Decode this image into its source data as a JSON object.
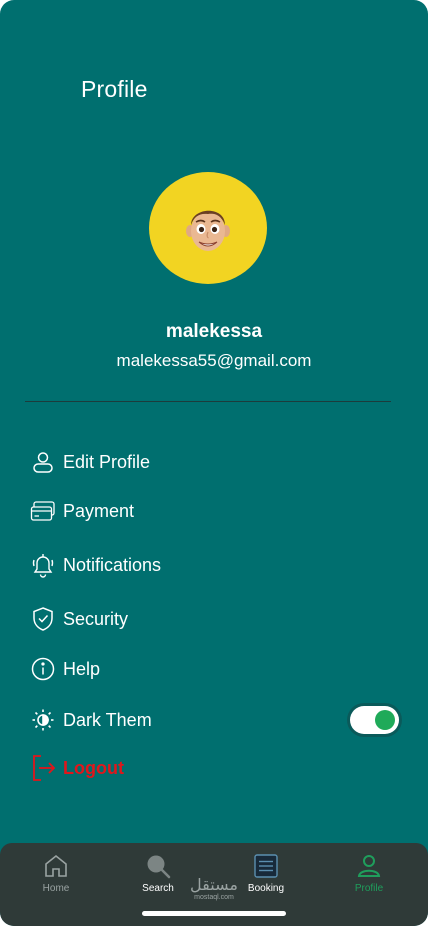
{
  "page": {
    "title": "Profile"
  },
  "user": {
    "name": "malekessa",
    "email": "malekessa55@gmail.com"
  },
  "menu": {
    "edit_profile": "Edit Profile",
    "payment": "Payment",
    "notifications": "Notifications",
    "security": "Security",
    "help": "Help",
    "dark_theme": "Dark Them",
    "logout": "Logout"
  },
  "settings": {
    "dark_theme_enabled": true
  },
  "nav": {
    "home": "Home",
    "search": "Search",
    "booking": "Booking",
    "profile": "Profile",
    "active": "profile"
  },
  "watermark": {
    "arabic": "مستقل",
    "latin": "mostaql.com"
  },
  "colors": {
    "background": "#006f6f",
    "avatar_bg": "#f2d422",
    "logout": "#e0161b",
    "toggle_on": "#1faa59",
    "nav_bg": "#2f3a38",
    "nav_active": "#1f9e5c"
  }
}
